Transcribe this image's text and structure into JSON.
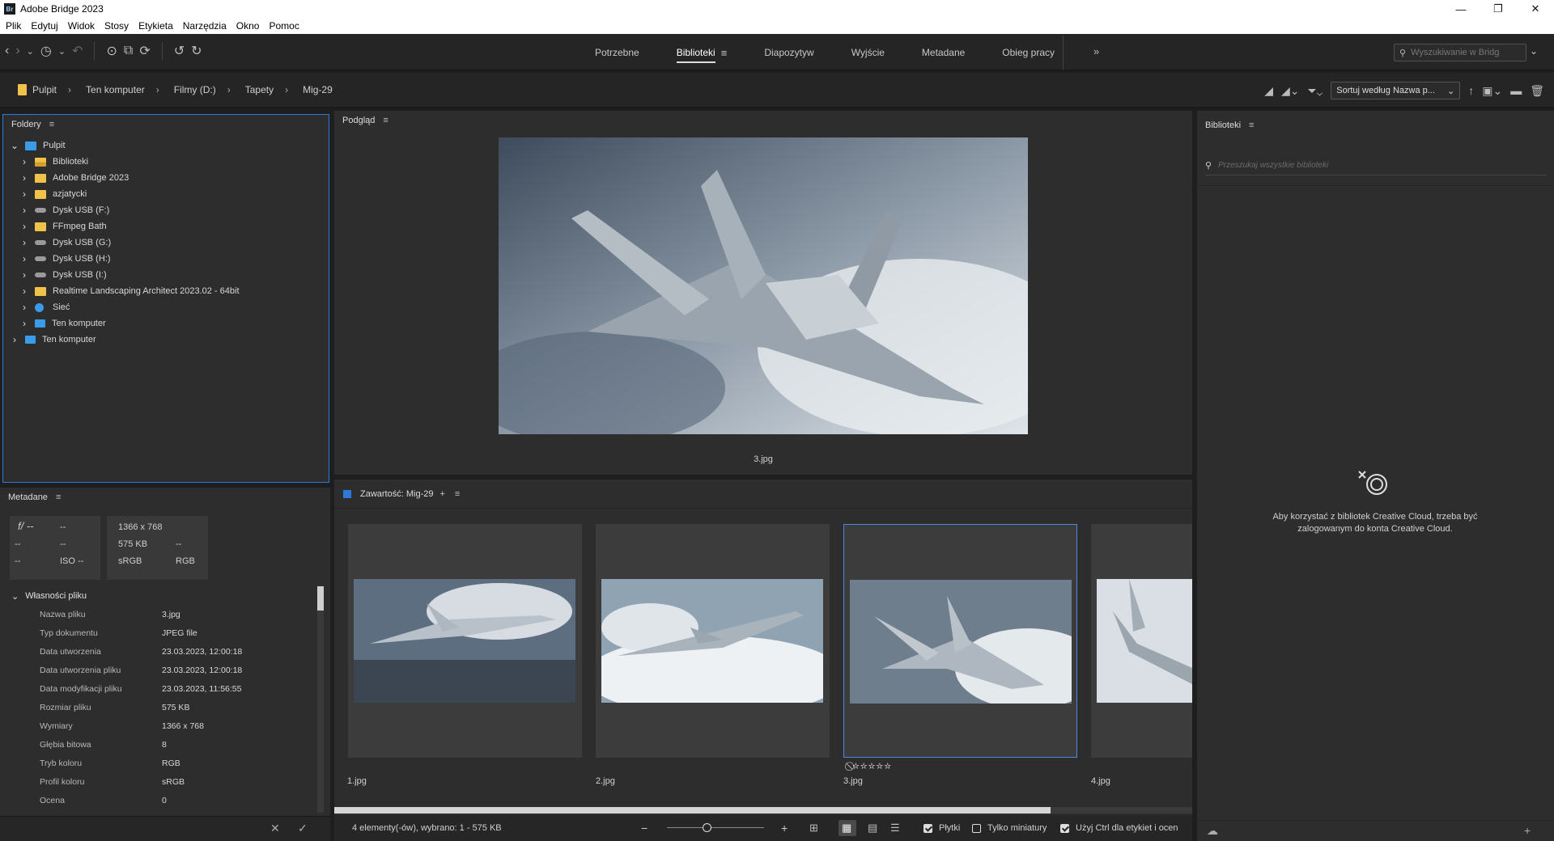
{
  "app": {
    "title": "Adobe Bridge 2023",
    "logo": "Br"
  },
  "window_controls": [
    "—",
    "❐",
    "✕"
  ],
  "menu": [
    "Plik",
    "Edytuj",
    "Widok",
    "Stosy",
    "Etykieta",
    "Narzędzia",
    "Okno",
    "Pomoc"
  ],
  "workspaces": {
    "items": [
      "Potrzebne",
      "Biblioteki",
      "Diapozytyw",
      "Wyjście",
      "Metadane",
      "Obieg pracy"
    ],
    "active": "Biblioteki",
    "more": "»"
  },
  "search": {
    "placeholder": "Wyszukiwanie w Bridg"
  },
  "breadcrumb": [
    "Pulpit",
    "Ten komputer",
    "Filmy (D:)",
    "Tapety",
    "Mig-29"
  ],
  "sort": {
    "label": "Sortuj według Nazwa p..."
  },
  "folders": {
    "title": "Foldery",
    "tree": [
      {
        "label": "Pulpit",
        "icon": "desktop-icon",
        "level": 0,
        "expanded": true
      },
      {
        "label": "Biblioteki",
        "icon": "libraries-icon",
        "level": 1
      },
      {
        "label": "Adobe Bridge 2023",
        "icon": "folder-icon",
        "level": 1
      },
      {
        "label": "azjatycki",
        "icon": "folder-icon",
        "level": 1
      },
      {
        "label": "Dysk USB (F:)",
        "icon": "drive-icon",
        "level": 1
      },
      {
        "label": "FFmpeg Bath",
        "icon": "folder-icon",
        "level": 1
      },
      {
        "label": "Dysk USB (G:)",
        "icon": "drive-icon",
        "level": 1
      },
      {
        "label": "Dysk USB (H:)",
        "icon": "drive-icon",
        "level": 1
      },
      {
        "label": "Dysk USB (I:)",
        "icon": "drive-icon",
        "level": 1
      },
      {
        "label": "Realtime Landscaping Architect 2023.02 - 64bit",
        "icon": "folder-icon",
        "level": 1
      },
      {
        "label": "Sieć",
        "icon": "network-icon",
        "level": 1
      },
      {
        "label": "Ten komputer",
        "icon": "computer-icon",
        "level": 1
      },
      {
        "label": "Ten komputer",
        "icon": "computer-icon",
        "level": 0
      }
    ]
  },
  "metadata": {
    "title": "Metadane",
    "quick": {
      "aperture": "f/ --",
      "a2": "--",
      "a3": "--",
      "a4": "--",
      "a5": "--",
      "iso": "ISO --",
      "dims": "1366 x 768",
      "size": "575 KB",
      "dash": "--",
      "profile": "sRGB",
      "mode": "RGB"
    },
    "section": "Własności pliku",
    "rows": [
      {
        "k": "Nazwa pliku",
        "v": "3.jpg"
      },
      {
        "k": "Typ dokumentu",
        "v": "JPEG file"
      },
      {
        "k": "Data utworzenia",
        "v": "23.03.2023, 12:00:18"
      },
      {
        "k": "Data utworzenia pliku",
        "v": "23.03.2023, 12:00:18"
      },
      {
        "k": "Data modyfikacji pliku",
        "v": "23.03.2023, 11:56:55"
      },
      {
        "k": "Rozmiar pliku",
        "v": "575 KB"
      },
      {
        "k": "Wymiary",
        "v": "1366 x 768"
      },
      {
        "k": "Głębia bitowa",
        "v": "8"
      },
      {
        "k": "Tryb koloru",
        "v": "RGB"
      },
      {
        "k": "Profil koloru",
        "v": "sRGB"
      },
      {
        "k": "Ocena",
        "v": "0"
      }
    ]
  },
  "preview": {
    "title": "Podgląd",
    "caption": "3.jpg"
  },
  "content": {
    "title": "Zawartość: Mig-29",
    "items": [
      "1.jpg",
      "2.jpg",
      "3.jpg",
      "4.jpg"
    ],
    "selected": "3.jpg",
    "stars": "⃠☆☆☆☆☆",
    "status": "4 elementy(-ów), wybrano: 1 - 575 KB",
    "opt_tiles": "Płytki",
    "opt_thumbs": "Tylko miniatury",
    "opt_ctrl": "Użyj Ctrl dla etykiet i ocen"
  },
  "libraries": {
    "title": "Biblioteki",
    "search_placeholder": "Przeszukaj wszystkie biblioteki",
    "message": "Aby korzystać z bibliotek Creative Cloud, trzeba być zalogowanym do konta Creative Cloud."
  },
  "colors": {
    "accent": "#2f7ad8",
    "panel": "#2d2d2d",
    "background": "#1e1e1e"
  }
}
